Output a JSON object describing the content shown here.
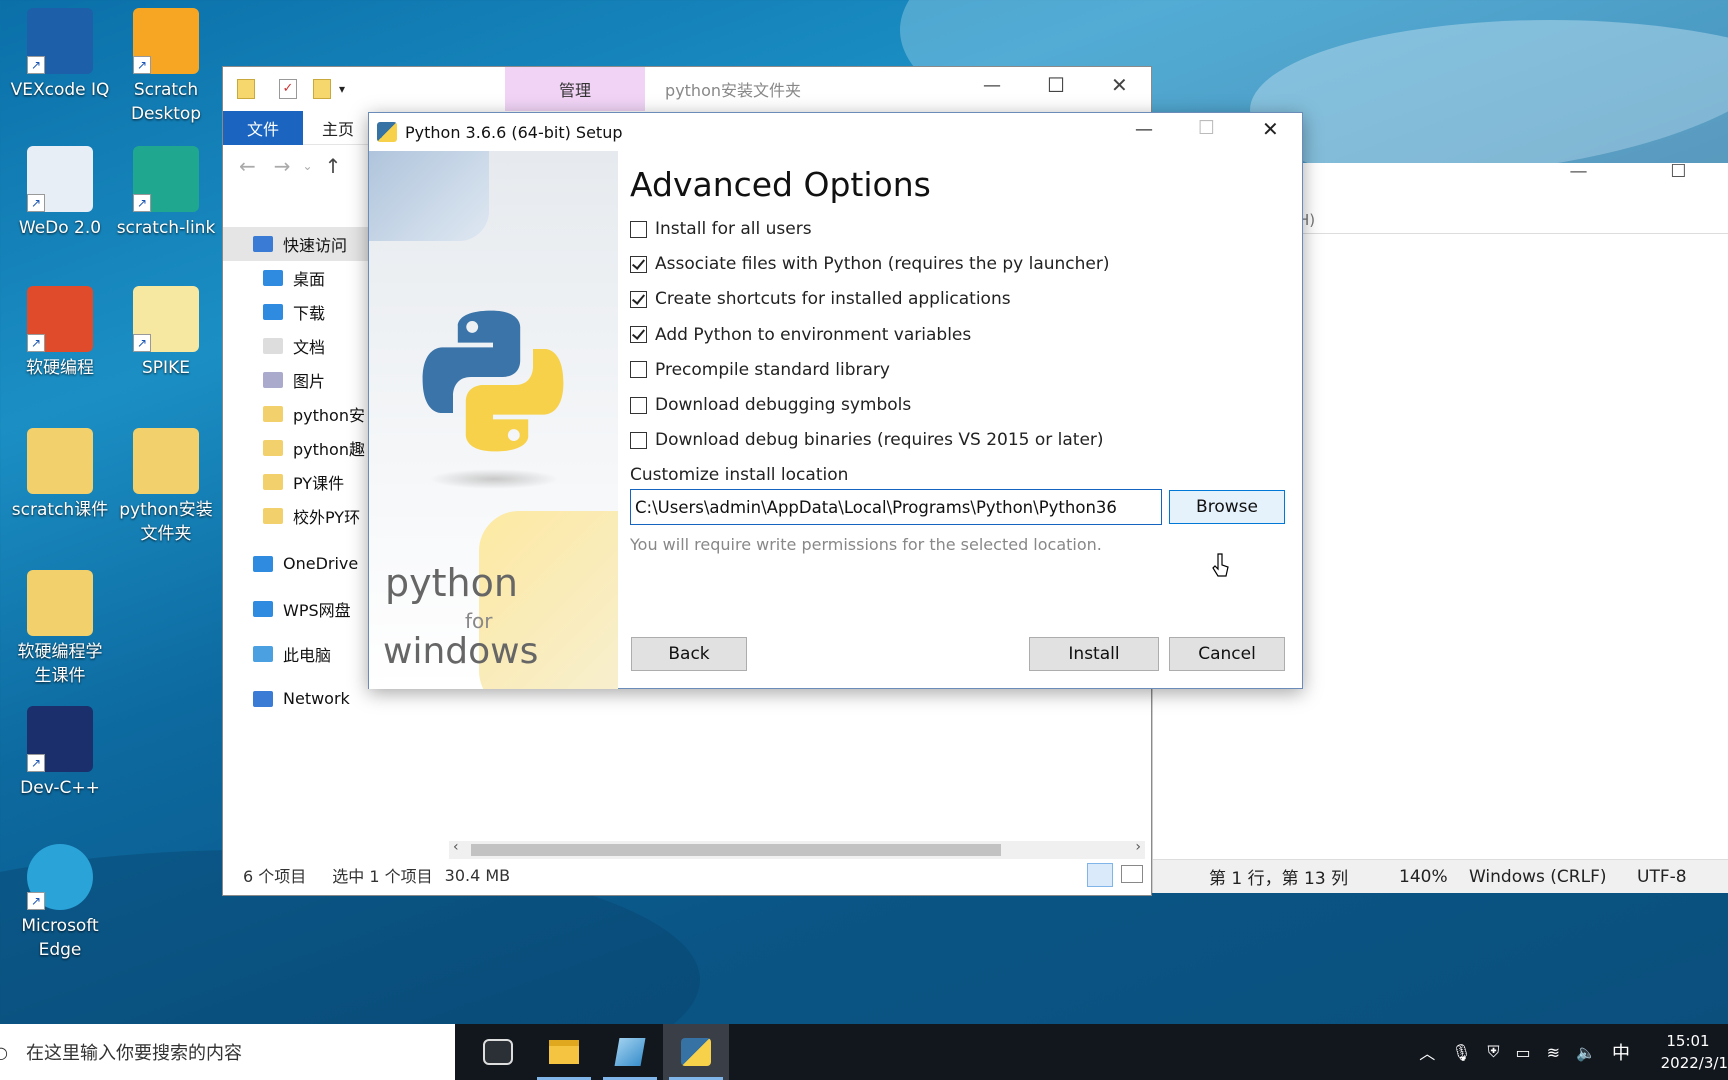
{
  "desktop": {
    "icons": [
      {
        "label": "VEXcode IQ",
        "icon": "vexcode-icon"
      },
      {
        "label": "Scratch\nDesktop",
        "icon": "scratch-icon"
      },
      {
        "label": "WeDo 2.0",
        "icon": "wedo-icon"
      },
      {
        "label": "scratch-link",
        "icon": "scratch-link-icon"
      },
      {
        "label": "软硬编程",
        "icon": "app-icon"
      },
      {
        "label": "SPIKE",
        "icon": "spike-icon"
      },
      {
        "label": "scratch课件",
        "icon": "folder-icon"
      },
      {
        "label": "python安装\n文件夹",
        "icon": "folder-icon"
      },
      {
        "label": "软硬编程学\n生课件",
        "icon": "folder-icon"
      },
      {
        "label": "Dev-C++",
        "icon": "devcpp-icon"
      },
      {
        "label": "Microsoft\nEdge",
        "icon": "edge-icon"
      }
    ]
  },
  "explorer": {
    "manage_tab": "管理",
    "title": "python安装文件夹",
    "file_tab": "文件",
    "home_tab": "主页",
    "nav": [
      {
        "label": "快速访问",
        "icon": "star-icon"
      },
      {
        "label": "桌面",
        "icon": "desktop-icon"
      },
      {
        "label": "下载",
        "icon": "download-icon"
      },
      {
        "label": "文档",
        "icon": "document-icon"
      },
      {
        "label": "图片",
        "icon": "picture-icon"
      },
      {
        "label": "python安",
        "icon": "folder-icon"
      },
      {
        "label": "python趣",
        "icon": "folder-icon"
      },
      {
        "label": "PY课件",
        "icon": "folder-icon"
      },
      {
        "label": "校外PY环",
        "icon": "folder-icon"
      },
      {
        "label": "OneDrive",
        "icon": "cloud-icon"
      },
      {
        "label": "WPS网盘",
        "icon": "cloud-icon"
      },
      {
        "label": "此电脑",
        "icon": "computer-icon"
      },
      {
        "label": "Network",
        "icon": "network-icon"
      }
    ],
    "status": {
      "items": "6 个项目",
      "selected": "选中 1 个项目",
      "size": "30.4 MB"
    }
  },
  "notepad": {
    "menu_fragment": "H)",
    "status": {
      "position": "第 1 行，第 13 列",
      "zoom": "140%",
      "line_ending": "Windows (CRLF)",
      "encoding": "UTF-8"
    }
  },
  "dialog": {
    "title": "Python 3.6.6 (64-bit) Setup",
    "heading": "Advanced Options",
    "options": [
      {
        "label": "Install for all users",
        "checked": false
      },
      {
        "label": "Associate files with Python (requires the py launcher)",
        "checked": true
      },
      {
        "label": "Create shortcuts for installed applications",
        "checked": true
      },
      {
        "label": "Add Python to environment variables",
        "checked": true
      },
      {
        "label": "Precompile standard library",
        "checked": false
      },
      {
        "label": "Download debugging symbols",
        "checked": false
      },
      {
        "label": "Download debug binaries (requires VS 2015 or later)",
        "checked": false
      }
    ],
    "location_label": "Customize install location",
    "location_value": "C:\\Users\\admin\\AppData\\Local\\Programs\\Python\\Python36",
    "browse": "Browse",
    "permission_note": "You will require write permissions for the selected location.",
    "back": "Back",
    "install": "Install",
    "cancel": "Cancel",
    "brand_line1": "python",
    "brand_line2": "for",
    "brand_line3": "windows"
  },
  "taskbar": {
    "search_placeholder": "在这里输入你要搜索的内容",
    "ime": "中",
    "time": "15:01",
    "date": "2022/3/1"
  }
}
